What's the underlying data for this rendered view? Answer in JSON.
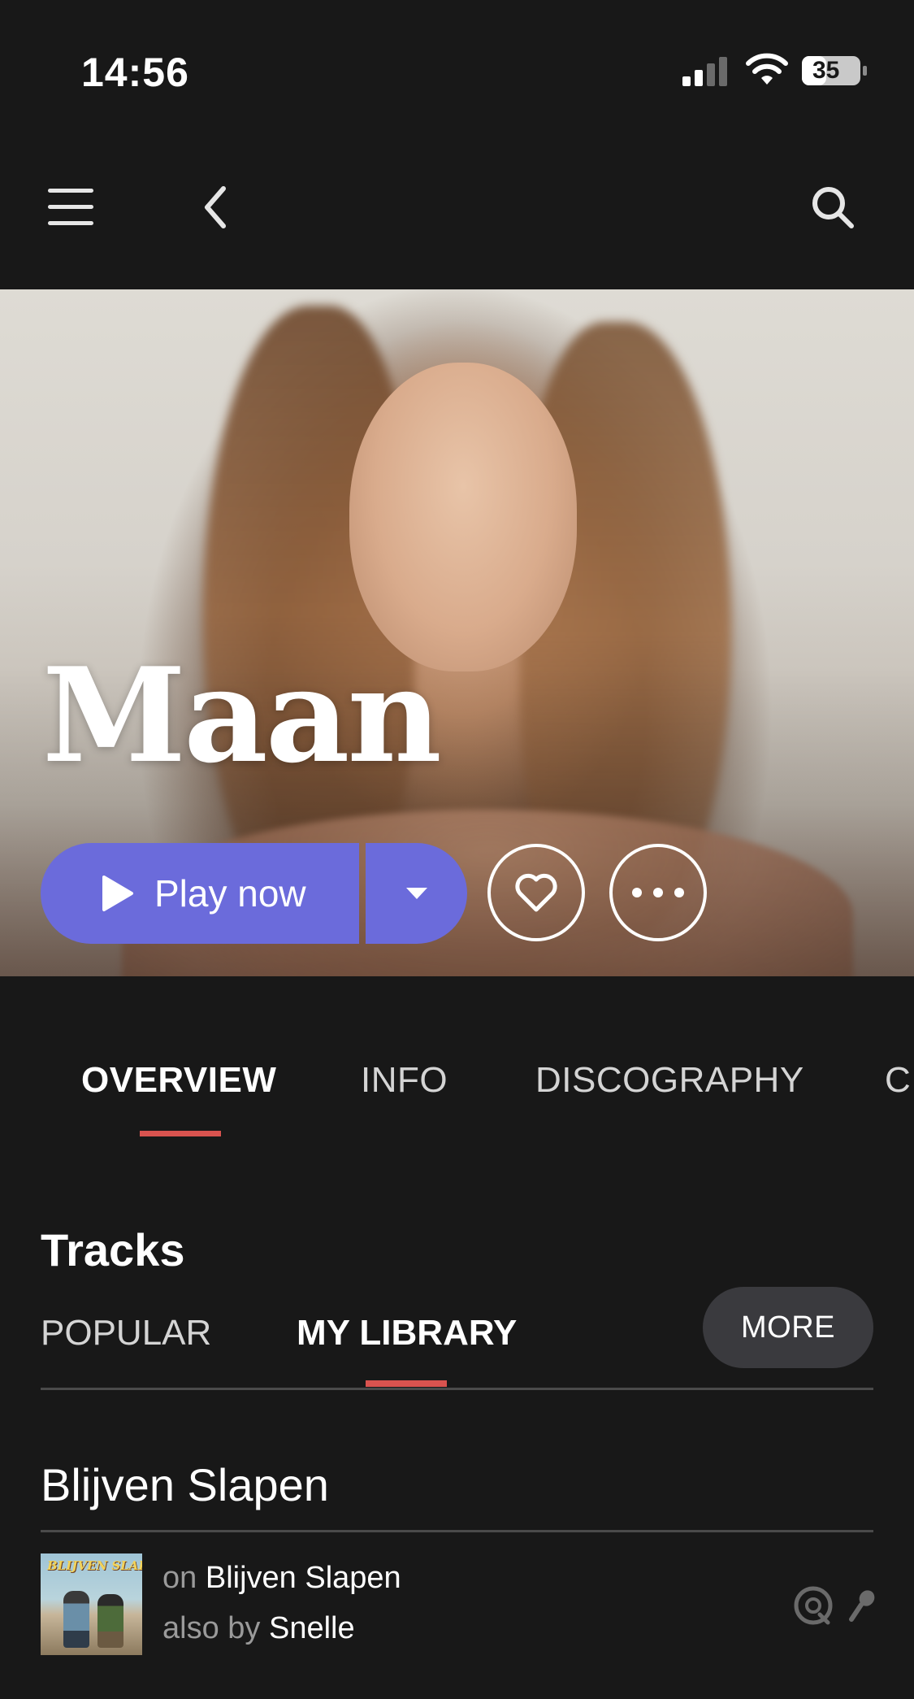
{
  "status_bar": {
    "time": "14:56",
    "battery": "35",
    "icons": [
      "signal-icon",
      "wifi-icon",
      "battery-icon"
    ]
  },
  "nav": {
    "icons": [
      "menu-icon",
      "back-chevron-icon",
      "search-icon"
    ]
  },
  "artist": {
    "name": "Maan"
  },
  "actions": {
    "play_label": "Play now",
    "icons": [
      "play-icon",
      "dropdown-caret-icon",
      "heart-icon",
      "more-dots-icon"
    ]
  },
  "tabs": [
    {
      "label": "OVERVIEW",
      "active": true
    },
    {
      "label": "INFO",
      "active": false
    },
    {
      "label": "DISCOGRAPHY",
      "active": false
    },
    {
      "label": "C",
      "active": false
    }
  ],
  "tracks": {
    "title": "Tracks",
    "subtabs": [
      {
        "label": "POPULAR",
        "active": false
      },
      {
        "label": "MY LIBRARY",
        "active": true
      }
    ],
    "more_label": "MORE",
    "album_title": "Blijven Slapen",
    "items": [
      {
        "on_prefix": "on",
        "album": "Blijven Slapen",
        "also_prefix": "also by",
        "also_artist": "Snelle",
        "art_text": "BLIJVEN SLAPEN",
        "icons": [
          "disc-icon",
          "microphone-icon"
        ]
      }
    ]
  },
  "colors": {
    "background": "#181818",
    "accent_purple": "#6b6bdb",
    "tab_indicator_red": "#d9534f",
    "pill_gray": "#3a3a3e"
  }
}
